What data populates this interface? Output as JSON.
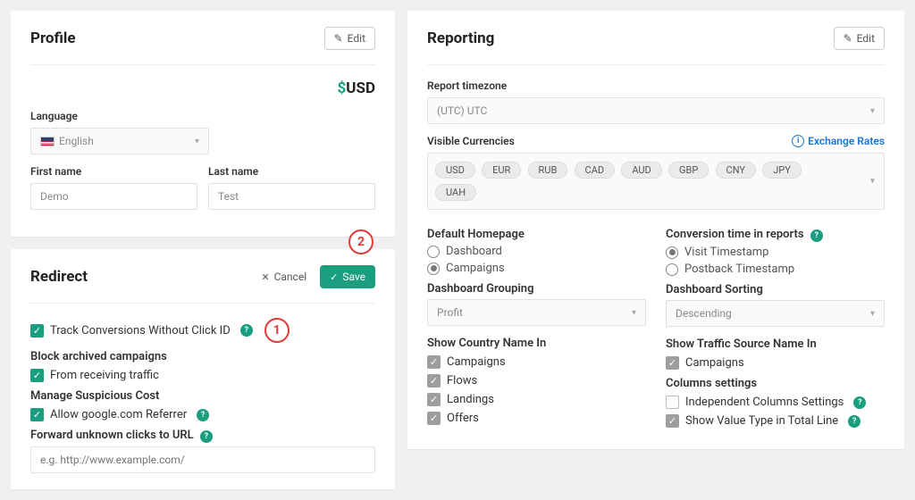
{
  "profile": {
    "title": "Profile",
    "edit_label": "Edit",
    "currency_symbol": "$",
    "currency_code": "USD",
    "language_label": "Language",
    "language_value": "English",
    "firstname_label": "First name",
    "firstname_value": "Demo",
    "lastname_label": "Last name",
    "lastname_value": "Test"
  },
  "redirect": {
    "title": "Redirect",
    "cancel_label": "Cancel",
    "save_label": "Save",
    "track_label": "Track Conversions Without Click ID",
    "block_section": "Block archived campaigns",
    "block_traffic": "From receiving traffic",
    "suspicious_section": "Manage Suspicious Cost",
    "allow_referrer": "Allow google.com Referrer",
    "forward_label": "Forward unknown clicks to URL",
    "forward_placeholder": "e.g. http://www.example.com/",
    "badge1": "1",
    "badge2": "2"
  },
  "reporting": {
    "title": "Reporting",
    "edit_label": "Edit",
    "timezone_label": "Report timezone",
    "timezone_value": "(UTC) UTC",
    "currencies_label": "Visible Currencies",
    "exchange_link": "Exchange Rates",
    "chips": [
      "USD",
      "EUR",
      "RUB",
      "CAD",
      "AUD",
      "GBP",
      "CNY",
      "JPY",
      "UAH"
    ],
    "homepage_label": "Default Homepage",
    "homepage_opts": [
      "Dashboard",
      "Campaigns"
    ],
    "conv_time_label": "Conversion time in reports",
    "conv_time_opts": [
      "Visit Timestamp",
      "Postback Timestamp"
    ],
    "dash_group_label": "Dashboard Grouping",
    "dash_group_value": "Profit",
    "dash_sort_label": "Dashboard Sorting",
    "dash_sort_value": "Descending",
    "country_name_label": "Show Country Name In",
    "country_opts": [
      "Campaigns",
      "Flows",
      "Landings",
      "Offers"
    ],
    "traffic_name_label": "Show Traffic Source Name In",
    "traffic_opt": "Campaigns",
    "columns_label": "Columns settings",
    "col_independent": "Independent Columns Settings",
    "col_value_type": "Show Value Type in Total Line"
  }
}
